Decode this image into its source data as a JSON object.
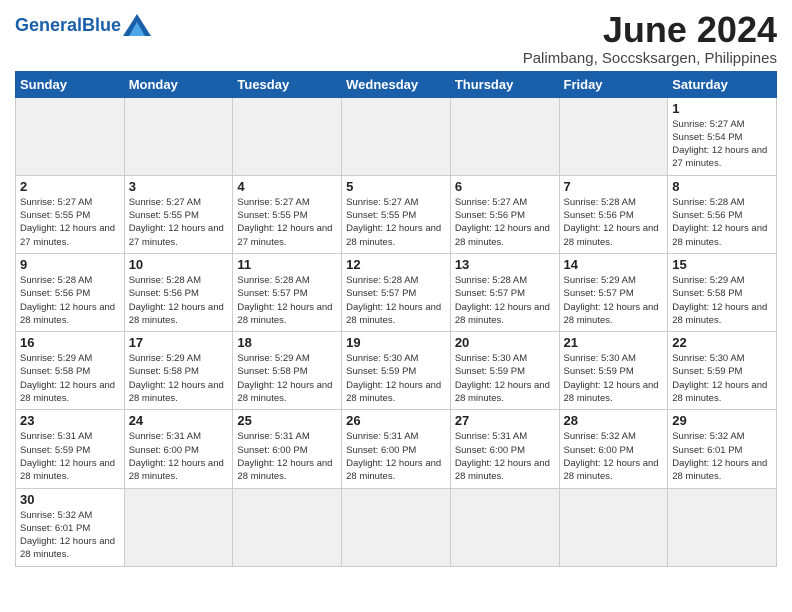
{
  "logo": {
    "text_general": "General",
    "text_blue": "Blue"
  },
  "title": "June 2024",
  "subtitle": "Palimbang, Soccsksargen, Philippines",
  "weekdays": [
    "Sunday",
    "Monday",
    "Tuesday",
    "Wednesday",
    "Thursday",
    "Friday",
    "Saturday"
  ],
  "weeks": [
    [
      {
        "day": "",
        "info": ""
      },
      {
        "day": "",
        "info": ""
      },
      {
        "day": "",
        "info": ""
      },
      {
        "day": "",
        "info": ""
      },
      {
        "day": "",
        "info": ""
      },
      {
        "day": "",
        "info": ""
      },
      {
        "day": "1",
        "info": "Sunrise: 5:27 AM\nSunset: 5:54 PM\nDaylight: 12 hours and 27 minutes."
      }
    ],
    [
      {
        "day": "2",
        "info": "Sunrise: 5:27 AM\nSunset: 5:55 PM\nDaylight: 12 hours and 27 minutes."
      },
      {
        "day": "3",
        "info": "Sunrise: 5:27 AM\nSunset: 5:55 PM\nDaylight: 12 hours and 27 minutes."
      },
      {
        "day": "4",
        "info": "Sunrise: 5:27 AM\nSunset: 5:55 PM\nDaylight: 12 hours and 27 minutes."
      },
      {
        "day": "5",
        "info": "Sunrise: 5:27 AM\nSunset: 5:55 PM\nDaylight: 12 hours and 28 minutes."
      },
      {
        "day": "6",
        "info": "Sunrise: 5:27 AM\nSunset: 5:56 PM\nDaylight: 12 hours and 28 minutes."
      },
      {
        "day": "7",
        "info": "Sunrise: 5:28 AM\nSunset: 5:56 PM\nDaylight: 12 hours and 28 minutes."
      },
      {
        "day": "8",
        "info": "Sunrise: 5:28 AM\nSunset: 5:56 PM\nDaylight: 12 hours and 28 minutes."
      }
    ],
    [
      {
        "day": "9",
        "info": "Sunrise: 5:28 AM\nSunset: 5:56 PM\nDaylight: 12 hours and 28 minutes."
      },
      {
        "day": "10",
        "info": "Sunrise: 5:28 AM\nSunset: 5:56 PM\nDaylight: 12 hours and 28 minutes."
      },
      {
        "day": "11",
        "info": "Sunrise: 5:28 AM\nSunset: 5:57 PM\nDaylight: 12 hours and 28 minutes."
      },
      {
        "day": "12",
        "info": "Sunrise: 5:28 AM\nSunset: 5:57 PM\nDaylight: 12 hours and 28 minutes."
      },
      {
        "day": "13",
        "info": "Sunrise: 5:28 AM\nSunset: 5:57 PM\nDaylight: 12 hours and 28 minutes."
      },
      {
        "day": "14",
        "info": "Sunrise: 5:29 AM\nSunset: 5:57 PM\nDaylight: 12 hours and 28 minutes."
      },
      {
        "day": "15",
        "info": "Sunrise: 5:29 AM\nSunset: 5:58 PM\nDaylight: 12 hours and 28 minutes."
      }
    ],
    [
      {
        "day": "16",
        "info": "Sunrise: 5:29 AM\nSunset: 5:58 PM\nDaylight: 12 hours and 28 minutes."
      },
      {
        "day": "17",
        "info": "Sunrise: 5:29 AM\nSunset: 5:58 PM\nDaylight: 12 hours and 28 minutes."
      },
      {
        "day": "18",
        "info": "Sunrise: 5:29 AM\nSunset: 5:58 PM\nDaylight: 12 hours and 28 minutes."
      },
      {
        "day": "19",
        "info": "Sunrise: 5:30 AM\nSunset: 5:59 PM\nDaylight: 12 hours and 28 minutes."
      },
      {
        "day": "20",
        "info": "Sunrise: 5:30 AM\nSunset: 5:59 PM\nDaylight: 12 hours and 28 minutes."
      },
      {
        "day": "21",
        "info": "Sunrise: 5:30 AM\nSunset: 5:59 PM\nDaylight: 12 hours and 28 minutes."
      },
      {
        "day": "22",
        "info": "Sunrise: 5:30 AM\nSunset: 5:59 PM\nDaylight: 12 hours and 28 minutes."
      }
    ],
    [
      {
        "day": "23",
        "info": "Sunrise: 5:31 AM\nSunset: 5:59 PM\nDaylight: 12 hours and 28 minutes."
      },
      {
        "day": "24",
        "info": "Sunrise: 5:31 AM\nSunset: 6:00 PM\nDaylight: 12 hours and 28 minutes."
      },
      {
        "day": "25",
        "info": "Sunrise: 5:31 AM\nSunset: 6:00 PM\nDaylight: 12 hours and 28 minutes."
      },
      {
        "day": "26",
        "info": "Sunrise: 5:31 AM\nSunset: 6:00 PM\nDaylight: 12 hours and 28 minutes."
      },
      {
        "day": "27",
        "info": "Sunrise: 5:31 AM\nSunset: 6:00 PM\nDaylight: 12 hours and 28 minutes."
      },
      {
        "day": "28",
        "info": "Sunrise: 5:32 AM\nSunset: 6:00 PM\nDaylight: 12 hours and 28 minutes."
      },
      {
        "day": "29",
        "info": "Sunrise: 5:32 AM\nSunset: 6:01 PM\nDaylight: 12 hours and 28 minutes."
      }
    ],
    [
      {
        "day": "30",
        "info": "Sunrise: 5:32 AM\nSunset: 6:01 PM\nDaylight: 12 hours and 28 minutes."
      },
      {
        "day": "",
        "info": ""
      },
      {
        "day": "",
        "info": ""
      },
      {
        "day": "",
        "info": ""
      },
      {
        "day": "",
        "info": ""
      },
      {
        "day": "",
        "info": ""
      },
      {
        "day": "",
        "info": ""
      }
    ]
  ]
}
